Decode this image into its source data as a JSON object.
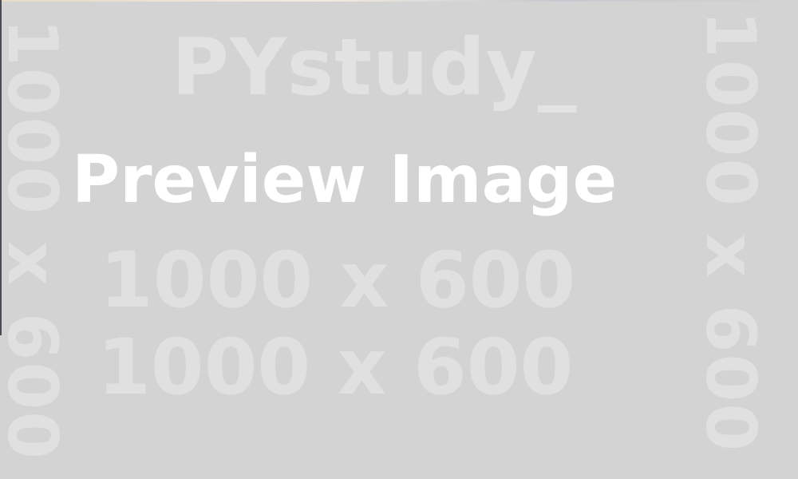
{
  "watermark": {
    "brand": "PYstudy_",
    "headline": "Preview Image",
    "dimensions_line_1": "1000 x 600",
    "dimensions_line_2": "1000 x 600",
    "side_left": "1000 x 600",
    "side_right": "1000 x 600"
  },
  "colors": {
    "background": "#d3d3d3",
    "watermark_text": "#e0e0e0",
    "headline_text": "#ffffff"
  }
}
